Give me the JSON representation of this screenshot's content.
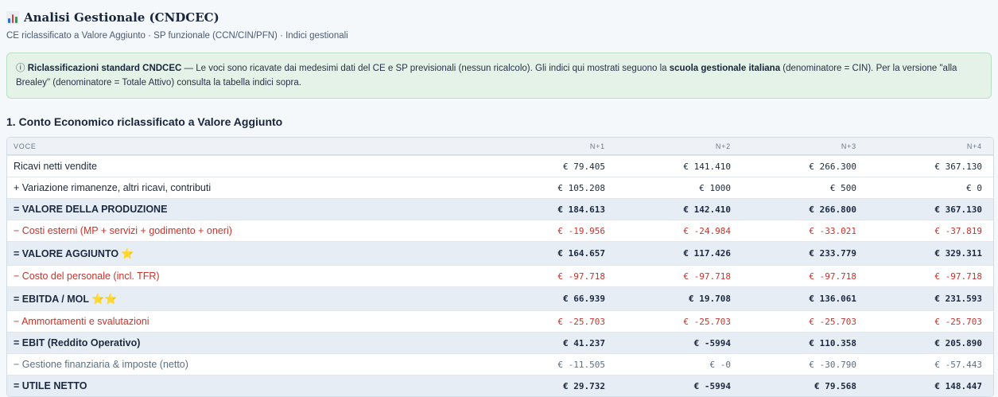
{
  "header": {
    "title": "Analisi Gestionale (CNDCEC)",
    "icon": "bar-chart-icon",
    "subtitle": "CE riclassificato a Valore Aggiunto · SP funzionale (CCN/CIN/PFN) · Indici gestionali"
  },
  "banner": {
    "icon": "ⓘ",
    "bold1": "Riclassificazioni standard CNDCEC",
    "text1": " — Le voci sono ricavate dai medesimi dati del CE e SP previsionali (nessun ricalcolo). Gli indici qui mostrati seguono la ",
    "bold2": "scuola gestionale italiana",
    "text2": " (denominatore = CIN). Per la versione \"alla Brealey\" (denominatore = Totale Attivo) consulta la tabella indici sopra."
  },
  "section": {
    "title": "1. Conto Economico riclassificato a Valore Aggiunto"
  },
  "table": {
    "columns": [
      "VOCE",
      "N+1",
      "N+2",
      "N+3",
      "N+4"
    ],
    "rows": [
      {
        "label": "Ricavi netti vendite",
        "values": [
          "€ 79.405",
          "€ 141.410",
          "€ 266.300",
          "€ 367.130"
        ]
      },
      {
        "label": "+ Variazione rimanenze, altri ricavi, contributi",
        "values": [
          "€ 105.208",
          "€ 1000",
          "€ 500",
          "€ 0"
        ]
      },
      {
        "label": "= VALORE DELLA PRODUZIONE",
        "values": [
          "€ 184.613",
          "€ 142.410",
          "€ 266.800",
          "€ 367.130"
        ]
      },
      {
        "label": "− Costi esterni (MP + servizi + godimento + oneri)",
        "values": [
          "€ -19.956",
          "€ -24.984",
          "€ -33.021",
          "€ -37.819"
        ]
      },
      {
        "label": "= VALORE AGGIUNTO",
        "stars": "⭐",
        "values": [
          "€ 164.657",
          "€ 117.426",
          "€ 233.779",
          "€ 329.311"
        ]
      },
      {
        "label": "− Costo del personale (incl. TFR)",
        "values": [
          "€ -97.718",
          "€ -97.718",
          "€ -97.718",
          "€ -97.718"
        ]
      },
      {
        "label": "= EBITDA / MOL",
        "stars": "⭐⭐",
        "values": [
          "€ 66.939",
          "€ 19.708",
          "€ 136.061",
          "€ 231.593"
        ]
      },
      {
        "label": "− Ammortamenti e svalutazioni",
        "values": [
          "€ -25.703",
          "€ -25.703",
          "€ -25.703",
          "€ -25.703"
        ]
      },
      {
        "label": "= EBIT (Reddito Operativo)",
        "values": [
          "€ 41.237",
          "€ -5994",
          "€ 110.358",
          "€ 205.890"
        ]
      },
      {
        "label": "− Gestione finanziaria & imposte (netto)",
        "values": [
          "€ -11.505",
          "€ -0",
          "€ -30.790",
          "€ -57.443"
        ]
      },
      {
        "label": "= UTILE NETTO",
        "values": [
          "€ 29.732",
          "€ -5994",
          "€ 79.568",
          "€ 148.447"
        ]
      }
    ]
  },
  "colors": {
    "negative": "#c8332b",
    "muted": "#5b6f86",
    "banner_bg": "#e4f2e8",
    "total_row_bg": "#e7edf4"
  }
}
